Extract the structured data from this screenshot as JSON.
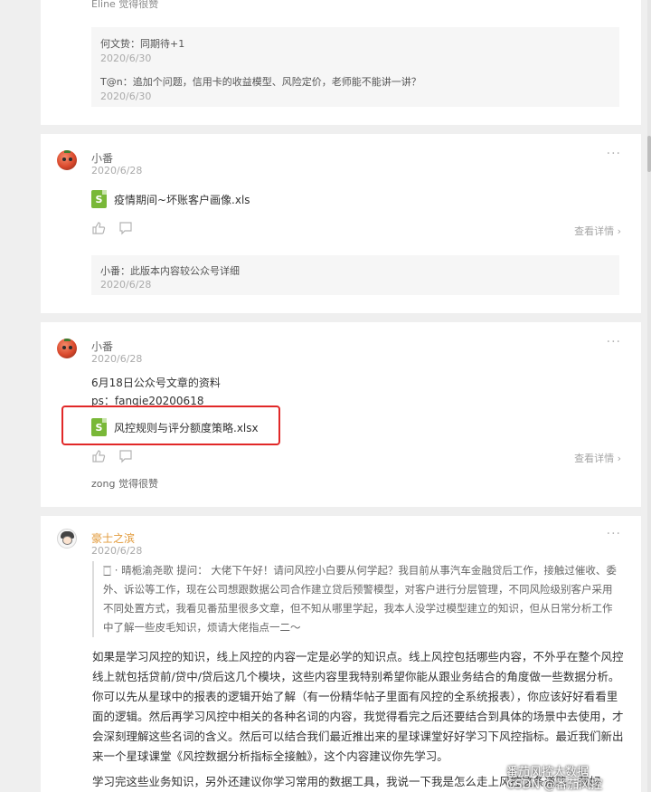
{
  "card1": {
    "top_text": "Eline 觉得很赞",
    "replies": [
      {
        "text": "何文贽：同期待+1",
        "date": "2020/6/30"
      },
      {
        "text": "T@n：追加个问题，信用卡的收益模型、风险定价，老师能不能讲一讲？",
        "date": "2020/6/30"
      }
    ]
  },
  "card2": {
    "name": "小番",
    "date": "2020/6/28",
    "more": "···",
    "file": "疫情期间~坏账客户画像.xls",
    "detail": "查看详情 ›",
    "reply": {
      "text": "小番：此版本内容较公众号详细",
      "date": "2020/6/28"
    }
  },
  "card3": {
    "name": "小番",
    "date": "2020/6/28",
    "more": "···",
    "line1": "6月18日公众号文章的资料",
    "line2": "ps：fanqie20200618",
    "file": "风控规则与评分额度策略.xlsx",
    "detail": "查看详情 ›",
    "likes": "zong 觉得很赞"
  },
  "card4": {
    "name": "豪士之滨",
    "date": "2020/6/28",
    "more": "···",
    "quote": "🀆 · 晴栀渝尧歌  提问：  大佬下午好！请问风控小白要从何学起？我目前从事汽车金融贷后工作，接触过催收、委外、诉讼等工作，现在公司想跟数据公司合作建立贷后预警模型，对客户进行分层管理，不同风险级别客户采用不同处置方式，我看见番茄里很多文章，但不知从哪里学起，我本人没学过模型建立的知识，但从日常分析工作中了解一些皮毛知识，烦请大佬指点一二～",
    "para1": "如果是学习风控的知识，线上风控的内容一定是必学的知识点。线上风控包括哪些内容，不外乎在整个风控线上就包括贷前/贷中/贷后这几个模块，这些内容里我特别希望你能从跟业务结合的角度做一些数据分析。你可以先从星球中的报表的逻辑开始了解（有一份精华帖子里面有风控的全系统报表），你应该好好看看里面的逻辑。然后再学习风控中相关的各种名词的内容，我觉得看完之后还要结合到具体的场景中去使用，才会深刻理解这些名词的含义。然后可以结合我们最近推出来的星球课堂好好学习下风控指标。最近我们新出来一个星球课堂《风控数据分析指标全接触》，这个内容建议你先学习。",
    "para2": "学习完这些业务知识，另外还建议你学习常用的数据工具，我说一下我是怎么走上风控这条道路，我好"
  },
  "watermark": {
    "line1": "番茄风控大数据",
    "line2": "CSDN @番茄风控"
  }
}
